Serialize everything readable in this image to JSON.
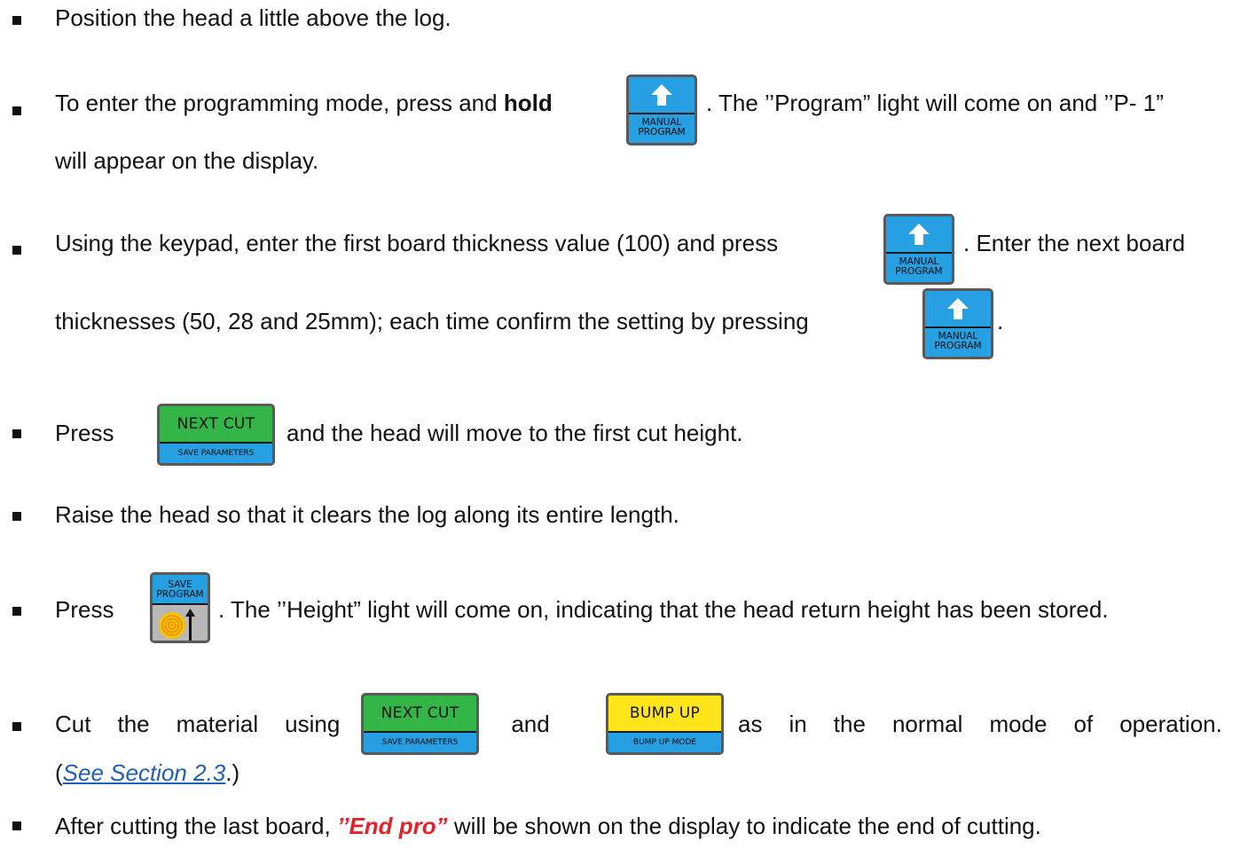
{
  "instructions": {
    "item1": {
      "text": "Position the head a little above the log."
    },
    "item2": {
      "line1_before": "To enter the programming mode, press and ",
      "line1_bold": "hold",
      "line1_after": ". The ’’Program” light will come on and ’’P- 1”",
      "line2": "will appear on the display."
    },
    "item3": {
      "line1_before": "Using the keypad, enter the first board thickness value (100) and press",
      "line1_after": ". Enter the next board",
      "line2_before": "thicknesses (50, 28 and 25mm); each time confirm the setting by pressing",
      "line2_after": "."
    },
    "item4": {
      "before": "Press",
      "after": "and the head will move to the first cut height."
    },
    "item5": {
      "text": "Raise the head so that it clears the log along its entire length."
    },
    "item6": {
      "before": "Press",
      "after": ". The ’’Height” light will come on, indicating that the head return height has been stored."
    },
    "item7": {
      "words": [
        "Cut",
        "the",
        "material",
        "using"
      ],
      "middle": "and",
      "tail_words": [
        ",",
        "as",
        "in",
        "the",
        "normal",
        "mode",
        "of",
        "operation."
      ],
      "line2_open": "(",
      "line2_link": "See Section 2.3",
      "line2_close": ".)"
    },
    "item8": {
      "before": "After cutting the last board, ",
      "emphasis": "’’End pro”",
      "after": " will be shown on the display to indicate the end of cutting."
    }
  },
  "keys": {
    "manual_program": {
      "label_line1": "MANUAL",
      "label_line2": "PROGRAM",
      "icon": "up-arrow-icon"
    },
    "next_cut": {
      "top_label": "NEXT CUT",
      "bottom_label": "SAVE PARAMETERS"
    },
    "bump_up": {
      "top_label": "BUMP UP",
      "bottom_label": "BUMP UP MODE"
    },
    "save_program": {
      "label_line1": "SAVE",
      "label_line2": "PROGRAM",
      "icon": "log-height-icon"
    }
  },
  "colors": {
    "key_blue": "#27a0e3",
    "key_green": "#33b547",
    "key_yellow": "#ffe51a",
    "key_border": "#5a5a5a",
    "emphasis_red": "#e3232a",
    "link_blue": "#1f5fb4"
  }
}
